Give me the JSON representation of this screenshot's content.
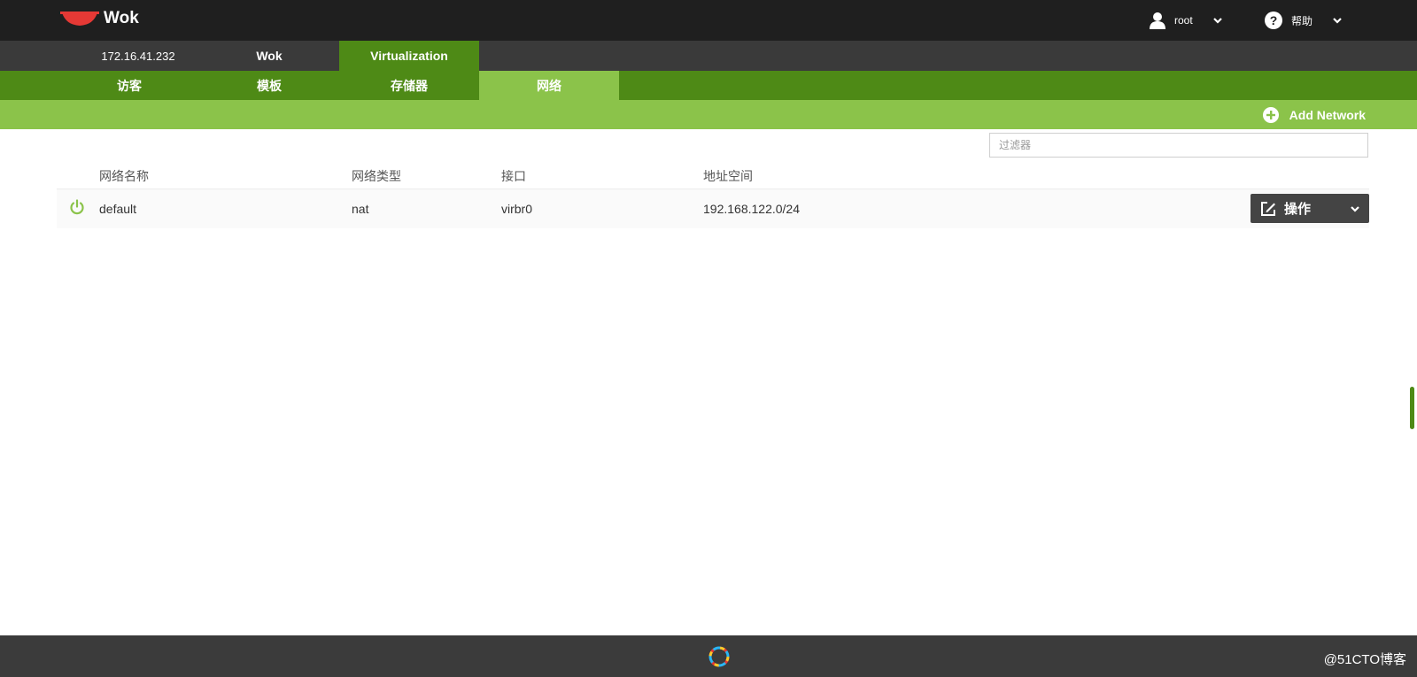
{
  "header": {
    "brand": "Wok",
    "user": "root",
    "help": "帮助",
    "icons": [
      "wok-logo",
      "user-icon",
      "help-icon",
      "chevron-down-icon"
    ]
  },
  "host_tabs": [
    {
      "label": "172.16.41.232"
    },
    {
      "label": "Wok"
    },
    {
      "label": "Virtualization"
    }
  ],
  "section_tabs": [
    {
      "label": "访客"
    },
    {
      "label": "模板"
    },
    {
      "label": "存储器"
    },
    {
      "label": "网络"
    }
  ],
  "actions": {
    "add_network": "Add Network"
  },
  "filter": {
    "placeholder": "过滤器",
    "value": ""
  },
  "table": {
    "columns": [
      "网络名称",
      "网络类型",
      "接口",
      "地址空间"
    ],
    "rows": [
      {
        "name": "default",
        "type": "nat",
        "interface": "virbr0",
        "address": "192.168.122.0/24",
        "state": "active",
        "action": "操作"
      }
    ]
  },
  "footer": {
    "watermark": "@51CTO博客"
  },
  "colors": {
    "topbar": "#1f1f1f",
    "hostbar": "#3a3a3a",
    "green_dark": "#4e8a16",
    "green_light": "#8bc34a",
    "footer": "#3b3b3b",
    "power_active": "#8bc34a"
  }
}
